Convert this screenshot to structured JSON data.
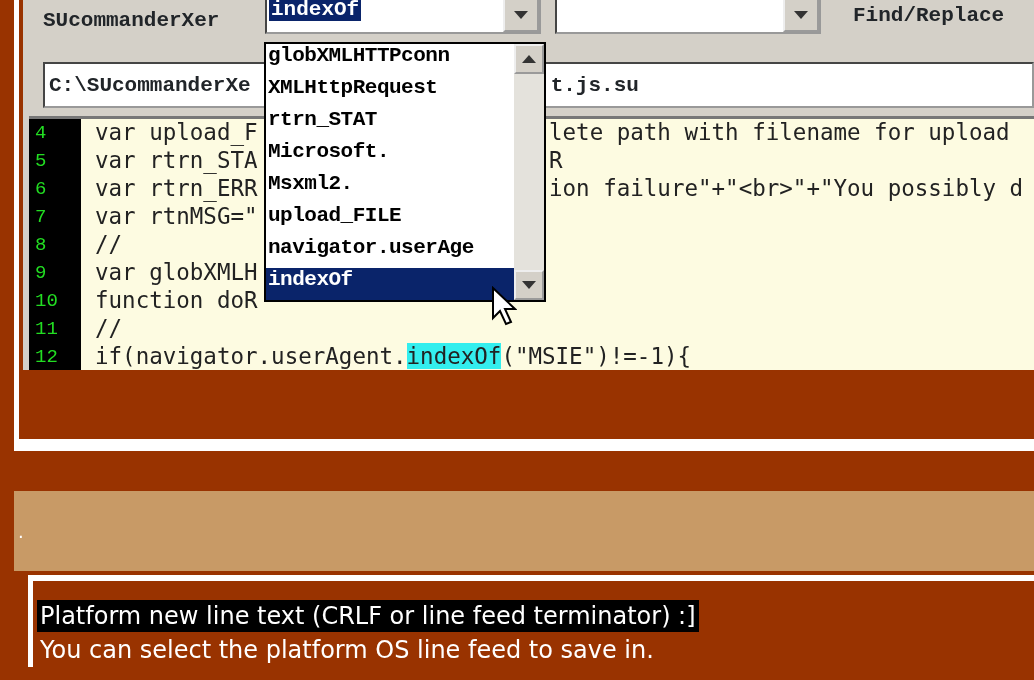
{
  "toolbar": {
    "label": "SUcommanderXer",
    "search_combo": {
      "value": "indexOf"
    },
    "find_replace_label": "Find/Replace"
  },
  "path_field": {
    "visible_start": "C:\\SUcommanderXe",
    "visible_end": "t.js.su"
  },
  "autocomplete": {
    "items": [
      {
        "label": "globXMLHTTPconn",
        "selected": false
      },
      {
        "label": "XMLHttpRequest",
        "selected": false
      },
      {
        "label": "rtrn_STAT",
        "selected": false
      },
      {
        "label": "Microsoft.",
        "selected": false
      },
      {
        "label": "Msxml2.",
        "selected": false
      },
      {
        "label": "upload_FILE",
        "selected": false
      },
      {
        "label": "navigator.userAge",
        "selected": false
      },
      {
        "label": "indexOf",
        "selected": true
      }
    ]
  },
  "code_lines": [
    {
      "number": "4",
      "segments": [
        {
          "text": "var upload_F",
          "highlighted": false
        }
      ],
      "continuation": "lete path with filename for upload"
    },
    {
      "number": "5",
      "segments": [
        {
          "text": "var rtrn_STA",
          "highlighted": false
        }
      ],
      "continuation": "R"
    },
    {
      "number": "6",
      "segments": [
        {
          "text": "var rtrn_ERR",
          "highlighted": false
        }
      ],
      "continuation": "ion failure\"+\"<br>\"+\"You possibly d"
    },
    {
      "number": "7",
      "segments": [
        {
          "text": "var rtnMSG=\"",
          "highlighted": false
        }
      ]
    },
    {
      "number": "8",
      "segments": [
        {
          "text": "//",
          "highlighted": false
        }
      ]
    },
    {
      "number": "9",
      "segments": [
        {
          "text": "var globXMLH",
          "highlighted": false
        }
      ]
    },
    {
      "number": "10",
      "segments": [
        {
          "text": "function doR",
          "highlighted": false
        }
      ]
    },
    {
      "number": "11",
      "segments": [
        {
          "text": "//",
          "highlighted": false
        }
      ]
    },
    {
      "number": "12",
      "segments": [
        {
          "text": "if(navigator.userAgent.",
          "highlighted": false
        },
        {
          "text": "indexOf",
          "highlighted": true
        },
        {
          "text": "(\"MSIE\")!=-1){",
          "highlighted": false
        }
      ]
    }
  ],
  "banner": {
    "text": "."
  },
  "notes": {
    "heading": "Platform new line text (CRLF or line feed terminator) :]",
    "lines": [
      "You can select the platform OS line feed to save in."
    ]
  }
}
